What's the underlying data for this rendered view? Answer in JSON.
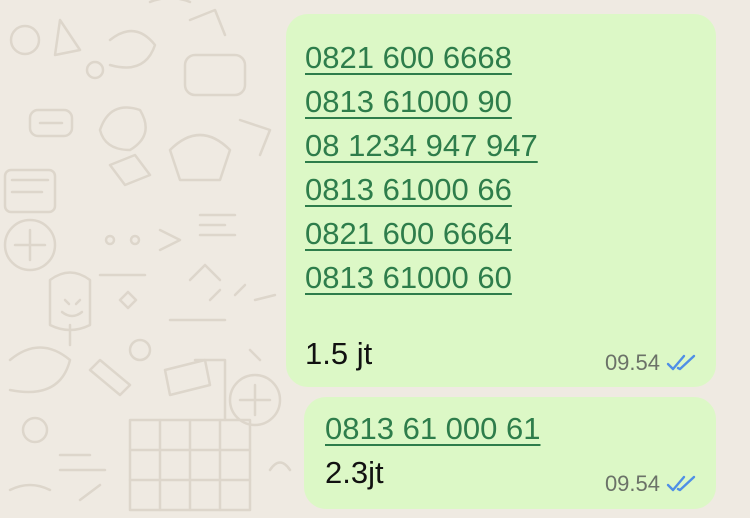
{
  "chat": {
    "messages": [
      {
        "phones": [
          "0821 600 6668",
          "0813 61000 90",
          "08 1234 947 947",
          "0813 61000 66",
          "0821 600 6664",
          "0813 61000 60"
        ],
        "text": "1.5 jt",
        "time": "09.54",
        "status_icon": "double-check-read-icon"
      },
      {
        "phones": [
          "0813 61 000 61"
        ],
        "text": "2.3jt",
        "time": "09.54",
        "status_icon": "double-check-read-icon"
      }
    ]
  },
  "colors": {
    "outgoing_bubble": "#dcf8c6",
    "link": "#2e7d4b",
    "read_ticks": "#4f8fe6",
    "time": "#6b7268",
    "wallpaper": "#efeae2"
  }
}
